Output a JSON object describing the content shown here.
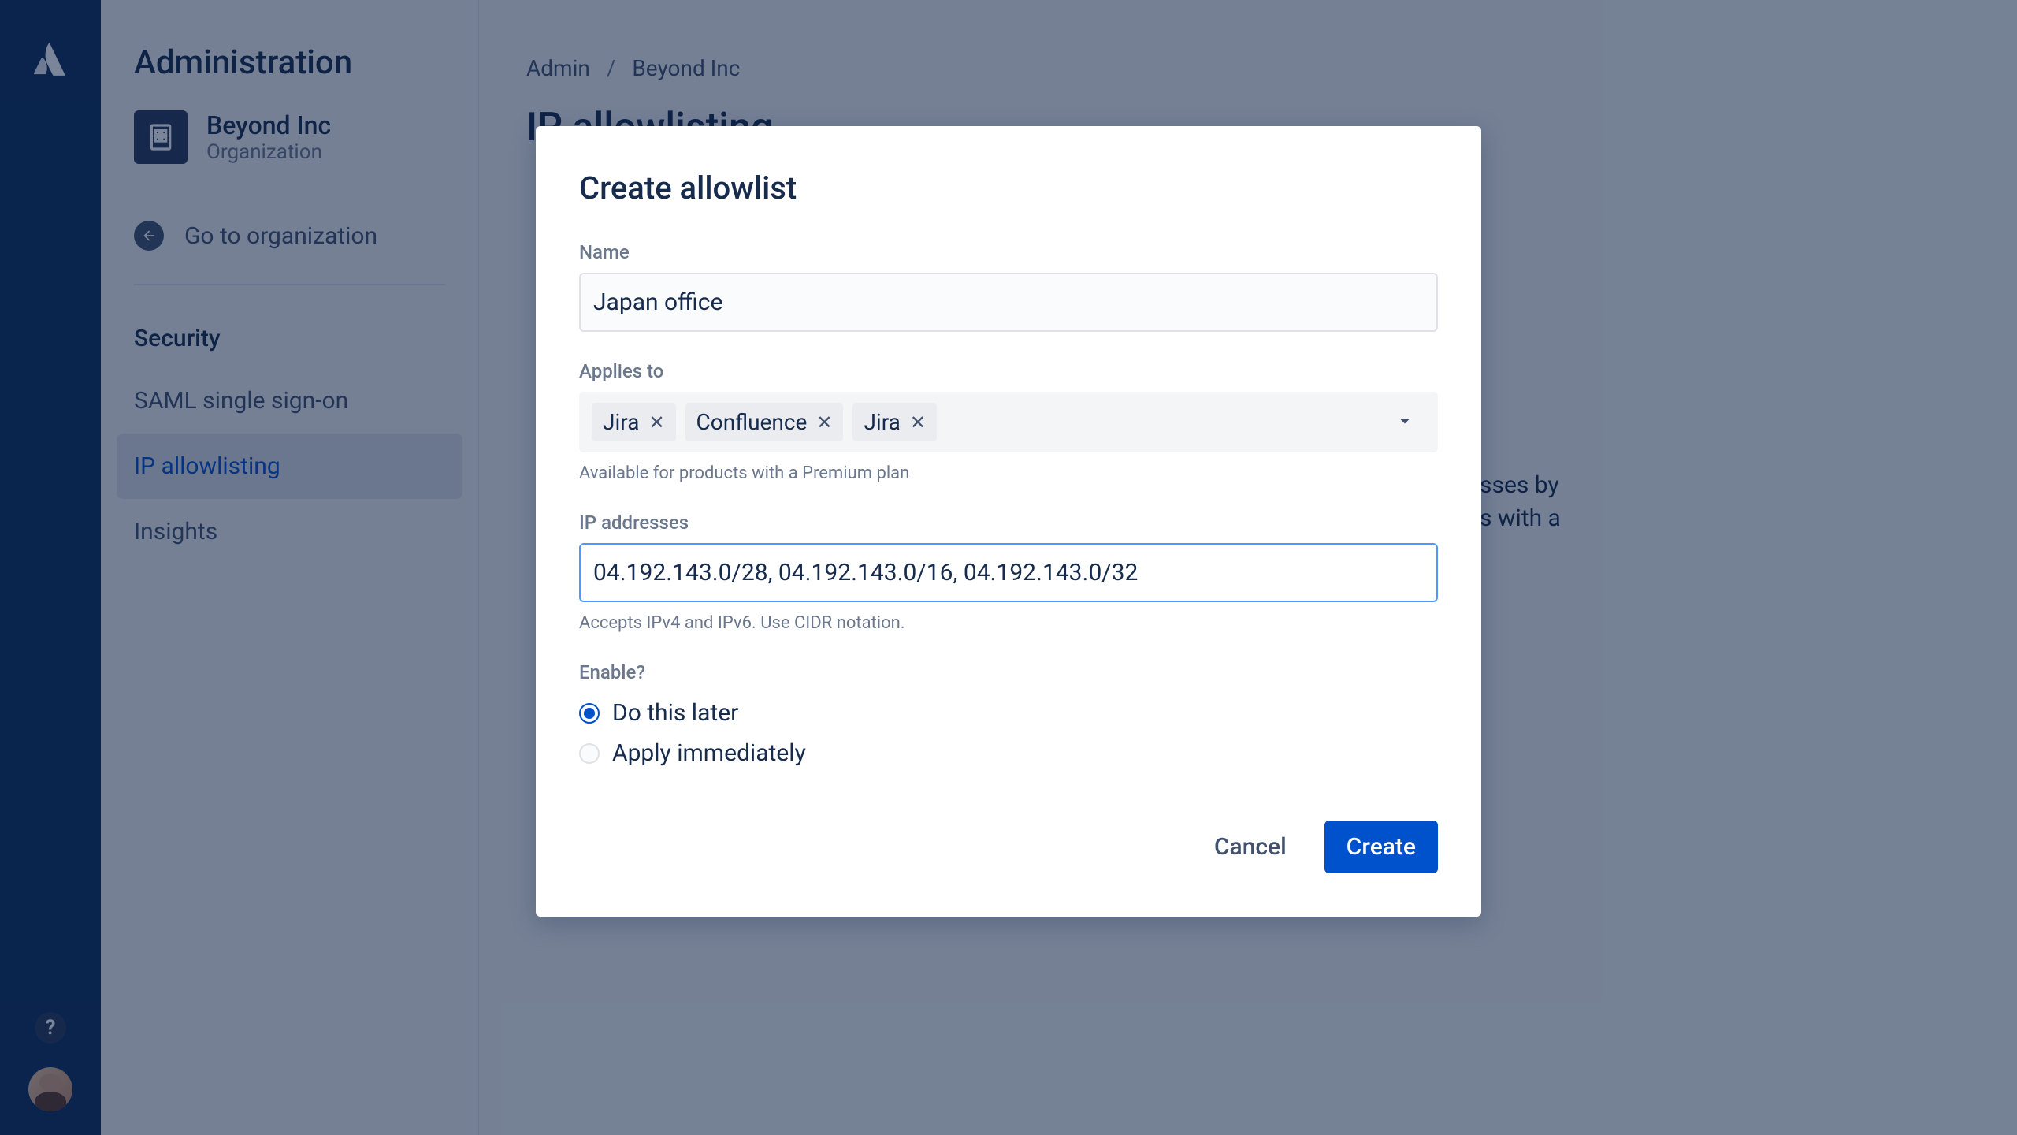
{
  "sidebar": {
    "title": "Administration",
    "orgName": "Beyond Inc",
    "orgSubtitle": "Organization",
    "goToOrg": "Go to organization",
    "sectionTitle": "Security",
    "items": [
      {
        "label": "SAML single sign-on",
        "active": false
      },
      {
        "label": "IP allowlisting",
        "active": true
      },
      {
        "label": "Insights",
        "active": false
      }
    ]
  },
  "breadcrumb": {
    "admin": "Admin",
    "org": "Beyond Inc"
  },
  "page": {
    "title": "IP allowlisting",
    "descFragment1": "sses by",
    "descFragment2": "s with a"
  },
  "modal": {
    "title": "Create allowlist",
    "nameLabel": "Name",
    "nameValue": "Japan office",
    "appliesToLabel": "Applies to",
    "tags": [
      "Jira",
      "Confluence",
      "Jira"
    ],
    "appliesToHelp": "Available for products with a Premium plan",
    "ipLabel": "IP addresses",
    "ipValue": "04.192.143.0/28, 04.192.143.0/16, 04.192.143.0/32",
    "ipHelp": "Accepts IPv4 and IPv6. Use CIDR notation.",
    "enableLabel": "Enable?",
    "radioOptions": [
      {
        "label": "Do this later",
        "checked": true
      },
      {
        "label": "Apply immediately",
        "checked": false
      }
    ],
    "cancelLabel": "Cancel",
    "createLabel": "Create"
  }
}
